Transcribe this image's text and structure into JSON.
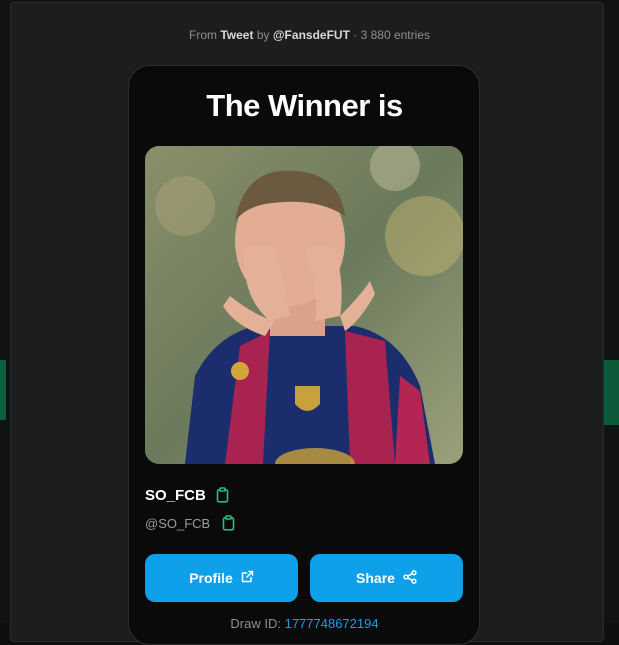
{
  "header": {
    "from_label": "From",
    "source": "Tweet",
    "by_label": "by",
    "author": "@FansdeFUT",
    "separator": "·",
    "entries": "3 880 entries"
  },
  "card": {
    "title": "The Winner is",
    "winner": {
      "name": "SO_FCB",
      "handle": "@SO_FCB"
    },
    "buttons": {
      "profile_label": "Profile",
      "share_label": "Share"
    },
    "draw": {
      "label": "Draw ID:",
      "id": "1777748672194"
    }
  },
  "colors": {
    "accent_button": "#0ea1ea",
    "copy_icon": "#22c07a",
    "draw_id_link": "#1a9fe6"
  },
  "icons": {
    "copy_name": "clipboard-icon",
    "copy_handle": "clipboard-icon",
    "profile": "external-link-icon",
    "share": "share-icon"
  }
}
